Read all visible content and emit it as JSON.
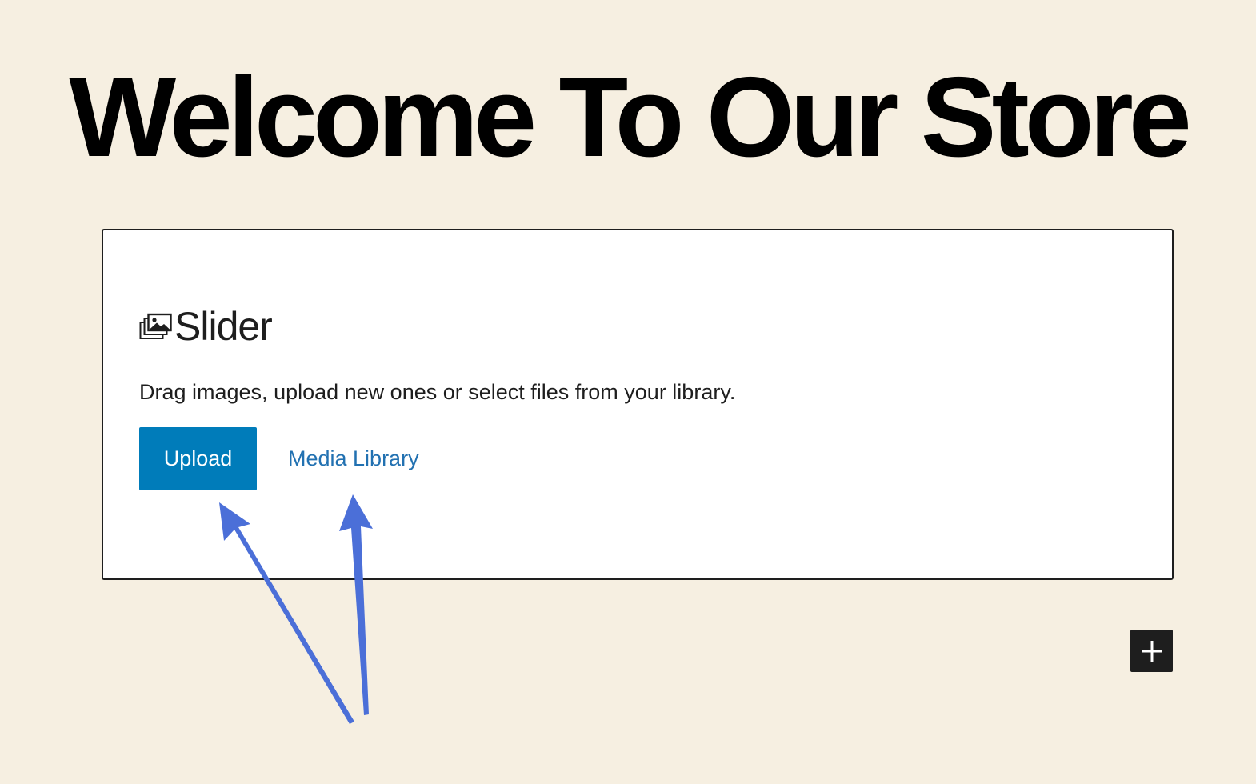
{
  "page": {
    "title": "Welcome To Our Store"
  },
  "slider_block": {
    "title": "Slider",
    "icon": "slider-gallery-icon",
    "instructions": "Drag images, upload new ones or select files from your library.",
    "upload_label": "Upload",
    "media_library_label": "Media Library"
  },
  "inserter": {
    "icon": "plus-icon"
  },
  "annotations": {
    "icon": "arrow-icon"
  },
  "colors": {
    "background": "#f6efe1",
    "primary_button": "#007cba",
    "link": "#2271b1",
    "arrow": "#4b6fd8",
    "dark": "#1e1e1e"
  }
}
